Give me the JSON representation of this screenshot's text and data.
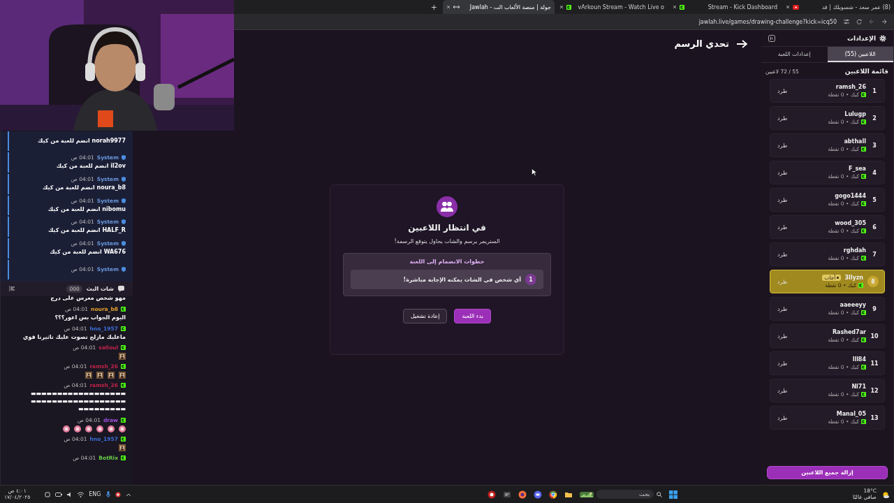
{
  "browser": {
    "tabs": [
      {
        "title": "(8) عمر سعد - شسويلك | قد",
        "kind": "video",
        "selected": false
      },
      {
        "title": "Stream - Kick Dashboard",
        "kind": "kick",
        "selected": false
      },
      {
        "title": "vArkoun Stream - Watch Live o",
        "kind": "kick",
        "selected": false
      },
      {
        "title": "جولة | منصة الألعاب الت - Jawlah",
        "kind": "site",
        "selected": true
      }
    ],
    "new_tab": "+",
    "address": "jawlah.live/games/drawing-challenge?kick=icq50"
  },
  "stream_chat": {
    "system_messages": [
      {
        "text": "norah9977 انضم للعبة من كيك"
      },
      {
        "author": "System",
        "time": "04:01 ص",
        "text": "il2ov انضم للعبة من كيك"
      },
      {
        "author": "System",
        "time": "04:01 ص",
        "text": "noura_b8 انضم للعبة من كيك"
      },
      {
        "author": "System",
        "time": "04:01 ص",
        "text": "nibomu انضم للعبة من كيك"
      },
      {
        "author": "System",
        "time": "04:01 ص",
        "text": "HALF_R انضم للعبة من كيك"
      },
      {
        "author": "System",
        "time": "04:01 ص",
        "text": "WA676 انضم للعبة من كيك"
      },
      {
        "author": "System",
        "time": "04:01 ص"
      }
    ],
    "title": "شات البث",
    "count": "000",
    "messages": [
      {
        "kind": "text",
        "text": "مهو شخص معرس على درج"
      },
      {
        "kind": "text",
        "author": "noura_b8",
        "color": "#e0a030",
        "time": "04:01 ص",
        "text": "اليوم الجواب بس اعور؟؟؟"
      },
      {
        "kind": "text",
        "author": "hno_1957",
        "color": "#3b6fd8",
        "time": "04:01 ص",
        "text": "ماعليك مازلح تصوت عليك تاثيرنا قوي"
      },
      {
        "kind": "emotes",
        "author": "salloul",
        "color": "#c0244a",
        "time": "04:01 ص"
      },
      {
        "kind": "emotes",
        "author": "ramsh_26",
        "color": "#c0244a",
        "time": "04:01 ص"
      },
      {
        "kind": "text",
        "author": "ramsh_26",
        "color": "#c0244a",
        "time": "04:01 ص",
        "text": "▬▬▬▬▬▬▬▬▬▬▬▬▬▬▬▬▬▬ ▬▬▬▬▬▬▬▬▬▬▬▬▬▬▬▬▬▬ ▬▬▬▬▬▬▬▬▬"
      },
      {
        "kind": "emotes",
        "author": "draw",
        "color": "#a050e0",
        "time": "04:01 ص",
        "emotes": [
          {
            "kind": "round"
          },
          {
            "kind": "round"
          },
          {
            "kind": "round"
          },
          {
            "kind": "round"
          },
          {
            "kind": "round"
          },
          {
            "kind": "round"
          }
        ]
      },
      {
        "kind": "emotes",
        "author": "hno_1957",
        "color": "#3b6fd8",
        "time": "04:01 ص"
      },
      {
        "kind": "text",
        "author": "BotRix",
        "color": "#6ad04a",
        "time": "04:01 ص"
      }
    ]
  },
  "stage": {
    "title": "تحدي الرسم",
    "dialog": {
      "title": "في انتظار اللاعبين",
      "subtitle": "الستريمر يرسم والشات يحاول يتوقع الرسمة!",
      "steps_title": "خطوات الانضمام إلى اللعبة",
      "steps": [
        {
          "number": "1",
          "text": "أي شخص في الشات يمكنه الإجابة مباشرة!"
        }
      ],
      "buttons": [
        {
          "label": "بدء اللعبة",
          "kind": "primary"
        },
        {
          "label": "إعادة تشغيل",
          "kind": "secondary"
        }
      ]
    }
  },
  "settings": {
    "title": "الإعدادات",
    "tabs": [
      {
        "label": "اللاعبين (55)",
        "selected": true
      },
      {
        "label": "إعدادات اللعبة",
        "selected": false
      }
    ],
    "list_title": "قائمة اللاعبين",
    "count": "55 / 72 لاعبين",
    "players": [
      {
        "rank": "1",
        "name": "ramsh_26",
        "meta": "كيك • 0 نقطة",
        "kick": "طرد",
        "highlighted": false
      },
      {
        "rank": "2",
        "name": "Lulugp",
        "meta": "كيك • 0 نقطة",
        "kick": "طرد",
        "highlighted": false
      },
      {
        "rank": "3",
        "name": "abthall",
        "meta": "كيك • 0 نقطة",
        "kick": "طرد",
        "highlighted": false
      },
      {
        "rank": "4",
        "name": "F_sea",
        "meta": "كيك • 0 نقطة",
        "kick": "طرد",
        "highlighted": false
      },
      {
        "rank": "5",
        "name": "gogo1444",
        "meta": "كيك • 0 نقطة",
        "kick": "طرد",
        "highlighted": false
      },
      {
        "rank": "6",
        "name": "wood_305",
        "meta": "كيك • 0 نقطة",
        "kick": "طرد",
        "highlighted": false
      },
      {
        "rank": "7",
        "name": "rghdah",
        "meta": "كيك • 0 نقطة",
        "kick": "طرد",
        "highlighted": false
      },
      {
        "rank": "8",
        "name": "3llyzn",
        "meta": "كيك • 0 نقطة",
        "kick": "طرد",
        "highlighted": true,
        "badge": "أجاب"
      },
      {
        "rank": "9",
        "name": "aaeeeyy",
        "meta": "كيك • 0 نقطة",
        "kick": "طرد",
        "highlighted": false
      },
      {
        "rank": "10",
        "name": "Rashed7ar",
        "meta": "كيك • 0 نقطة",
        "kick": "طرد",
        "highlighted": false
      },
      {
        "rank": "11",
        "name": "lll84",
        "meta": "كيك • 0 نقطة",
        "kick": "طرد",
        "highlighted": false
      },
      {
        "rank": "12",
        "name": "Nl71",
        "meta": "كيك • 0 نقطة",
        "kick": "طرد",
        "highlighted": false
      },
      {
        "rank": "13",
        "name": "Manal_05",
        "meta": "كيك • 0 نقطة",
        "kick": "طرد",
        "highlighted": false
      }
    ],
    "remove_all": "إزالة جميع اللاعبين"
  },
  "taskbar": {
    "time": "٤:٠١ ص",
    "date": "١٧/٠٤/٢٠٢٥",
    "language": "ENG",
    "search": {
      "placeholder": "بحث"
    },
    "weather": {
      "temperature": "18°C",
      "condition": "صافي غالبًا"
    }
  }
}
